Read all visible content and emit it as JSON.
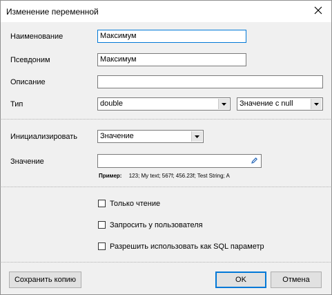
{
  "window": {
    "title": "Изменение переменной"
  },
  "fields": {
    "name_label": "Наименование",
    "name_value": "Максимум",
    "alias_label": "Псевдоним",
    "alias_value": "Максимум",
    "description_label": "Описание",
    "description_value": "",
    "type_label": "Тип",
    "type_value": "double",
    "nullability_value": "Значение с null",
    "init_label": "Инициализировать",
    "init_value": "Значение",
    "value_label": "Значение",
    "value_value": "",
    "example_label": "Пример:",
    "example_text": "123; My text; 567f; 456.23f; Test String; A"
  },
  "options": {
    "read_only": {
      "label": "Только чтение",
      "checked": false
    },
    "ask_user": {
      "label": "Запросить у пользователя",
      "checked": false
    },
    "sql_param": {
      "label": "Разрешить использовать как SQL параметр",
      "checked": false
    }
  },
  "buttons": {
    "save_copy": "Сохранить копию",
    "ok": "OK",
    "cancel": "Отмена"
  },
  "icons": {
    "close": "close-icon",
    "dropdown": "chevron-down-icon",
    "edit": "pencil-icon"
  }
}
